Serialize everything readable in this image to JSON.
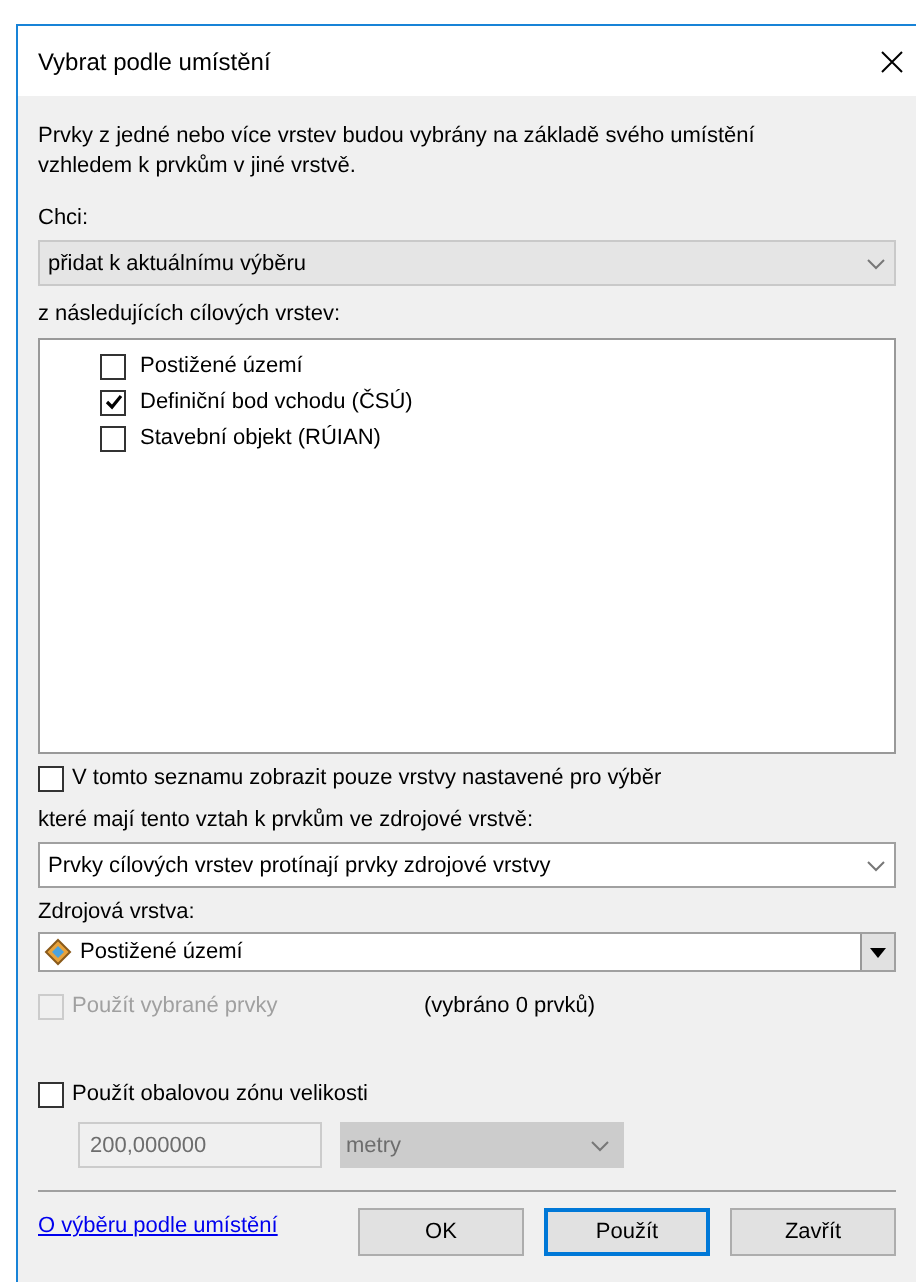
{
  "window": {
    "title": "Vybrat podle umístění"
  },
  "description": "Prvky z jedné nebo více vrstev budou vybrány na základě svého umístění vzhledem k prvkům v jiné vrstvě.",
  "method": {
    "label": "Chci:",
    "value": "přidat k aktuálnímu výběru",
    "disabled": false
  },
  "target_layers": {
    "label": "z následujících cílových vrstev:",
    "items": [
      {
        "label": "Postižené území",
        "checked": false
      },
      {
        "label": "Definiční bod vchodu (ČSÚ)",
        "checked": true
      },
      {
        "label": "Stavební objekt (RÚIAN)",
        "checked": false
      }
    ]
  },
  "only_selectable": {
    "label": "V tomto seznamu zobrazit pouze vrstvy nastavené pro výběr",
    "checked": false
  },
  "relation": {
    "label": "které mají tento vztah k prvkům ve zdrojové vrstvě:",
    "value": "Prvky cílových vrstev protínají prvky zdrojové vrstvy"
  },
  "source_layer": {
    "label": "Zdrojová vrstva:",
    "value": "Postižené území"
  },
  "use_selected": {
    "label": "Použít vybrané prvky",
    "checked": false,
    "disabled": true,
    "count": "(vybráno 0 prvků)"
  },
  "buffer": {
    "label": "Použít obalovou zónu velikosti",
    "checked": false,
    "distance": "200,000000",
    "unit": "metry",
    "disabled": true
  },
  "help_link": "O výběru podle umístění",
  "buttons": [
    {
      "label": "OK",
      "default": false
    },
    {
      "label": "Použít",
      "default": true
    },
    {
      "label": "Zavřít",
      "default": false
    }
  ]
}
